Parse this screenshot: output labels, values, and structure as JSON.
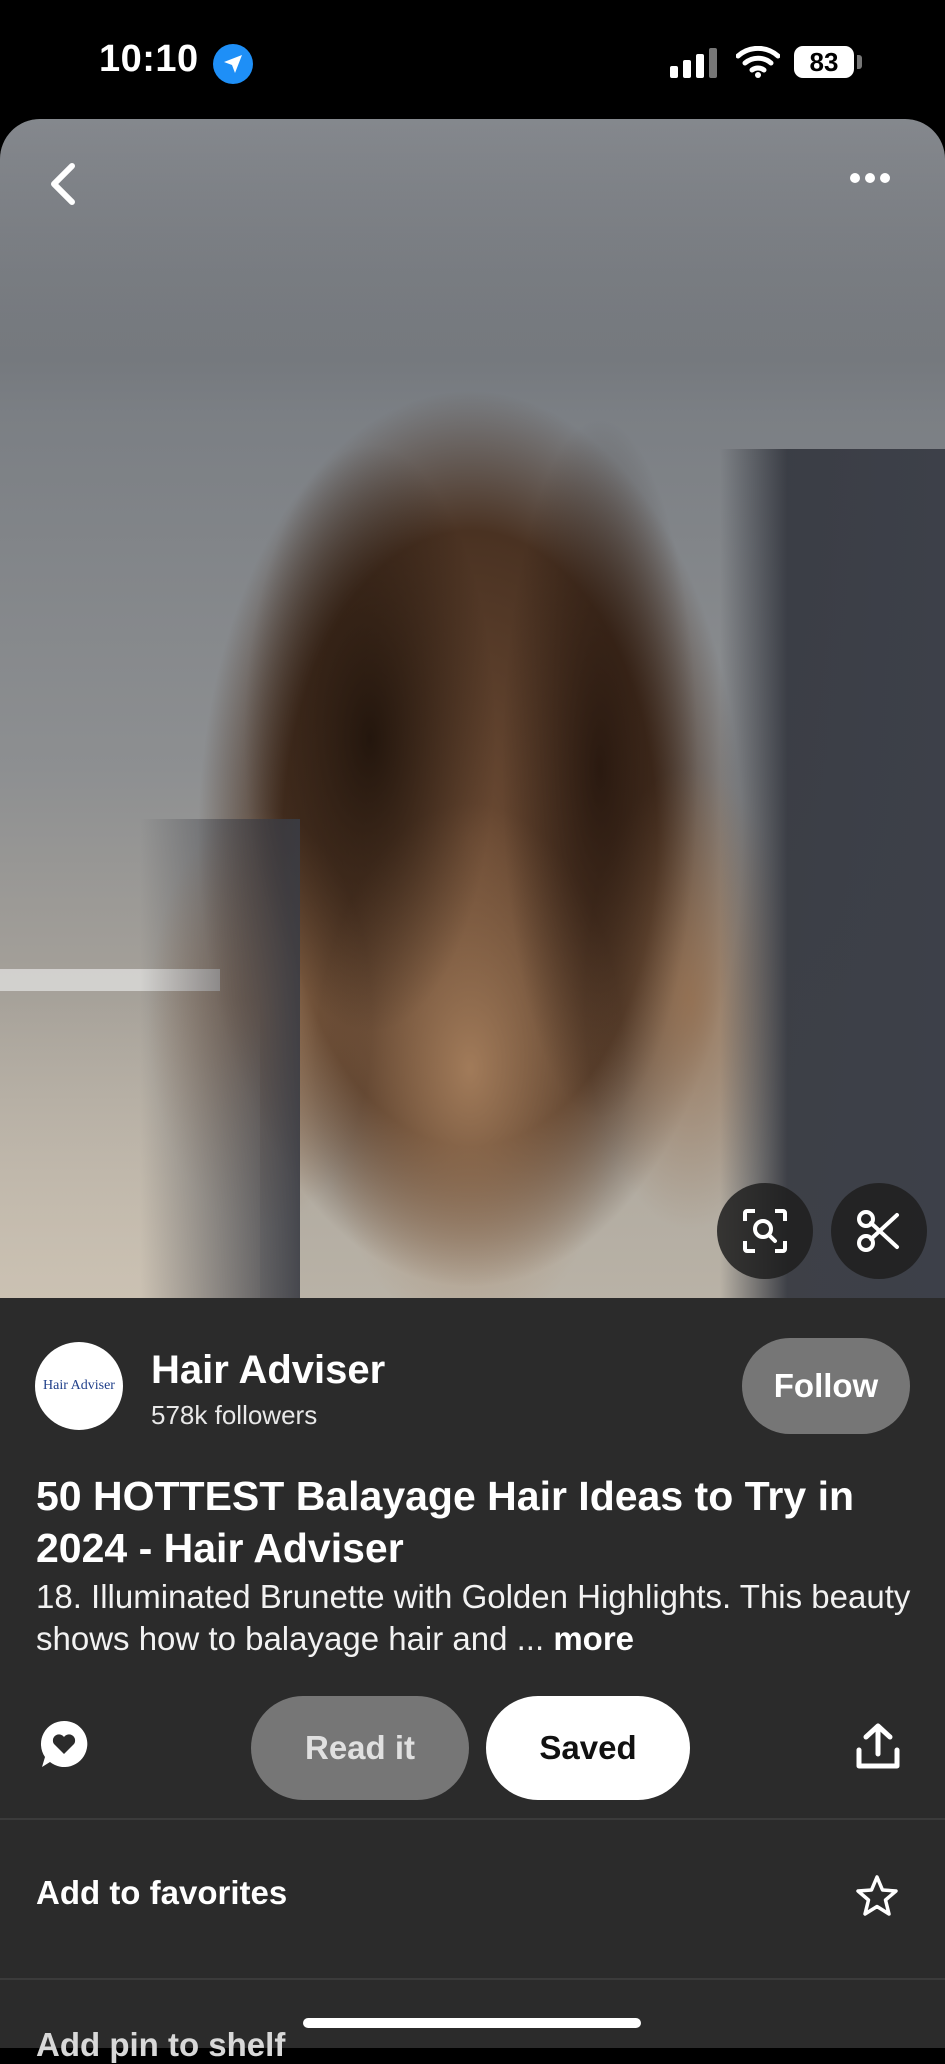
{
  "status_bar": {
    "time": "10:10",
    "battery": "83"
  },
  "pin": {
    "image_alt": "Woman with long wavy brunette balayage hair",
    "author": {
      "name": "Hair Adviser",
      "followers": "578k followers",
      "avatar_text": "Hair Adviser"
    },
    "follow_label": "Follow",
    "title": "50 HOTTEST Balayage Hair Ideas to Try in 2024 - Hair Adviser",
    "description": "18. Illuminated Brunette with Golden Highlights. This beauty shows how to balayage hair and ...",
    "more_label": "more"
  },
  "actions": {
    "read_it": "Read it",
    "saved": "Saved"
  },
  "options": {
    "favorites": "Add to favorites",
    "add_to_shelf": "Add pin to shelf"
  },
  "icons": [
    "chevron-left-icon",
    "more-horizontal-icon",
    "visual-search-icon",
    "scissors-icon",
    "comment-icon",
    "share-icon",
    "star-icon"
  ],
  "colors": {
    "background": "#2b2b2b",
    "button_gray": "#767676",
    "accent_blue": "#1e8ff7"
  }
}
